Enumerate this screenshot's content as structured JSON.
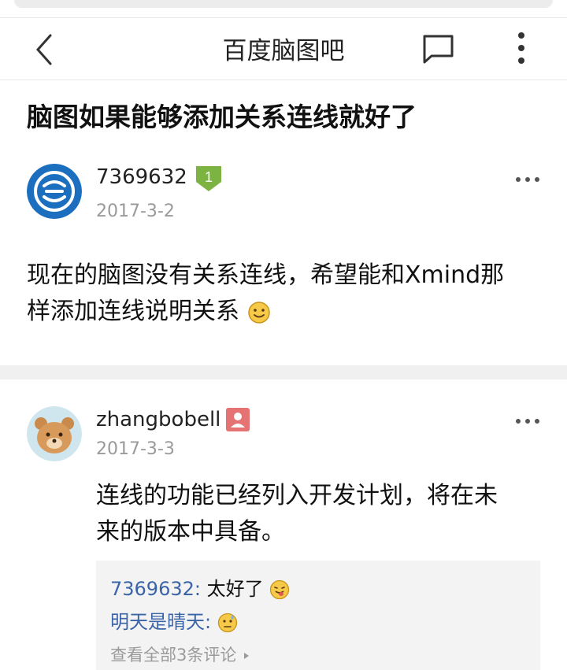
{
  "header": {
    "title": "百度脑图吧"
  },
  "post": {
    "title": "脑图如果能够添加关系连线就好了",
    "author": "7369632",
    "level_badge": "1",
    "date": "2017-3-2",
    "content_line1": "现在的脑图没有关系连线，希望能和Xmind那",
    "content_line2": "样添加连线说明关系"
  },
  "reply": {
    "author": "zhangbobell",
    "date": "2017-3-3",
    "content_line1": "连线的功能已经列入开发计划，将在未",
    "content_line2": "来的版本中具备。",
    "sub_replies": [
      {
        "name": "7369632:",
        "text": "太好了"
      },
      {
        "name": "明天是晴天:",
        "text": ""
      }
    ],
    "view_all": "查看全部3条评论"
  },
  "colors": {
    "link": "#3a64a8",
    "badge_green": "#7cb342",
    "badge_red": "#e57373",
    "date_gray": "#9a9a9a",
    "divider": "#f0f0f0"
  },
  "icons": [
    "back-icon",
    "comment-icon",
    "more-icon",
    "level-badge-icon",
    "user-badge-icon",
    "smile-emoji-icon",
    "tongue-emoji-icon",
    "sweat-emoji-icon",
    "chevron-right-icon"
  ]
}
